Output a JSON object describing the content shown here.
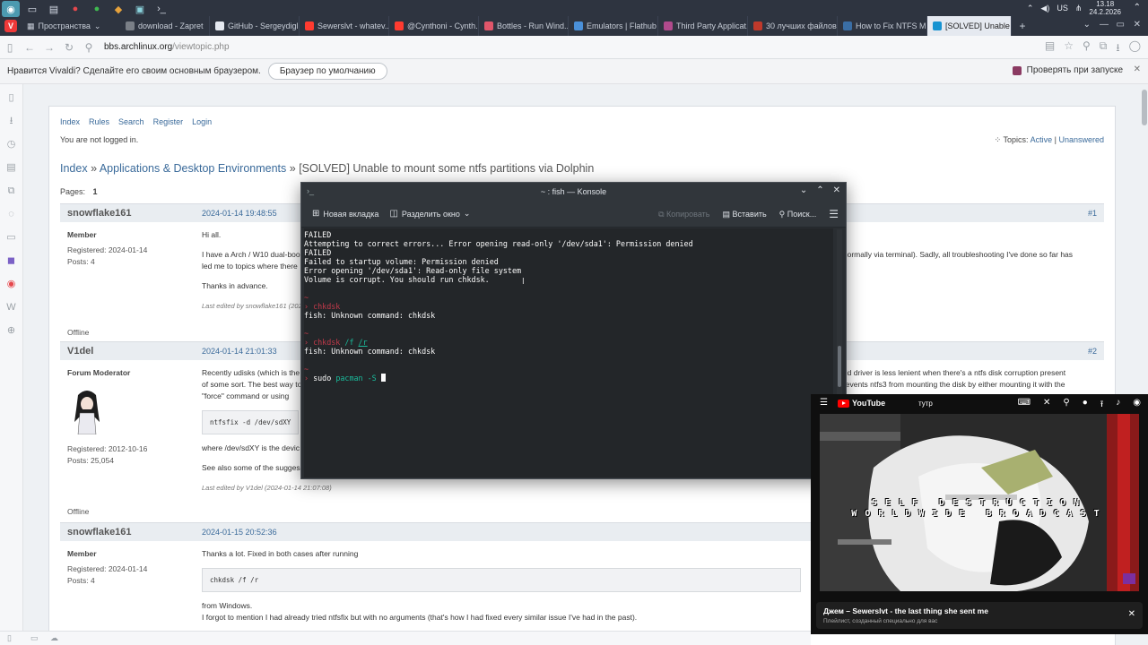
{
  "system": {
    "workspace_label": "Пространства",
    "keyboard_layout": "US",
    "time": "13.18",
    "date": "24.2.2026"
  },
  "tabs": [
    {
      "label": "download - Zapret",
      "color": "#7a7f87"
    },
    {
      "label": "GitHub - Sergeydigl...",
      "color": "#e5e9f0"
    },
    {
      "label": "Sewerslvt - whatev...",
      "color": "#ff3b30"
    },
    {
      "label": "@Cynthoni - Cynth...",
      "color": "#ff3b30"
    },
    {
      "label": "Bottles - Run Wind...",
      "color": "#e0566a"
    },
    {
      "label": "Emulators | Flathub",
      "color": "#4a90d9"
    },
    {
      "label": "Third Party Applicat...",
      "color": "#b04a8c"
    },
    {
      "label": "30 лучших файлов...",
      "color": "#c0392b"
    },
    {
      "label": "How to Fix NTFS M...",
      "color": "#3a6ea5"
    },
    {
      "label": "[SOLVED] Unable to m...",
      "color": "#1793d1"
    }
  ],
  "address": {
    "host": "bbs.archlinux.org",
    "path": "/viewtopic.php"
  },
  "notification": {
    "message": "Нравится Vivaldi? Сделайте его своим основным браузером.",
    "button": "Браузер по умолчанию",
    "checkbox_label": "Проверять при запуске"
  },
  "forum": {
    "nav": [
      "Index",
      "Rules",
      "Search",
      "Register",
      "Login"
    ],
    "not_logged": "You are not logged in.",
    "topics_label": "Topics:",
    "topics_active": "Active",
    "topics_sep": "|",
    "topics_unanswered": "Unanswered",
    "breadcrumb": {
      "index": "Index",
      "sep": "»",
      "category": "Applications & Desktop Environments",
      "current": "[SOLVED] Unable to mount some ntfs partitions via Dolphin"
    },
    "pages_label": "Pages:",
    "pages_current": "1",
    "posts": [
      {
        "author": "snowflake161",
        "date": "2024-01-14 19:48:55",
        "num": "#1",
        "role": "Member",
        "registered": "Registered: 2024-01-14",
        "postcount": "Posts: 4",
        "body": [
          "Hi all.",
          "I have a Arch / W10 dual-boo",
          "led me to topics where there",
          "Thanks in advance."
        ],
        "body_right": "hem normally via terminal). Sadly, all troubleshooting I've done so far has",
        "edited": "Last edited by snowflake161 (202",
        "status": "Offline"
      },
      {
        "author": "V1del",
        "date": "2024-01-14 21:01:33",
        "num": "#2",
        "role": "Forum Moderator",
        "registered": "Registered: 2012-10-16",
        "postcount": "Posts: 25,054",
        "body": [
          "Recently udisks (which is the",
          "of some sort. The best way to",
          "\"force\" command or using"
        ],
        "body_right_1": "el. Said driver is less lenient when there's a ntfs disk corruption present",
        "body_right_2": "hat prevents ntfs3 from mounting the disk by either mounting it with the",
        "code": "ntfsfix -d /dev/sdXY",
        "after_code": "where /dev/sdXY is the devic",
        "see_also": "See also some of the sugges",
        "edited": "Last edited by V1del (2024-01-14 21:07:08)",
        "status": "Offline"
      },
      {
        "author": "snowflake161",
        "date": "2024-01-15 20:52:36",
        "num": "#3",
        "role": "Member",
        "registered": "Registered: 2024-01-14",
        "postcount": "Posts: 4",
        "body_first": "Thanks a lot. Fixed in both cases after running",
        "code": "chkdsk /f /r",
        "after_code_1": "from Windows.",
        "after_code_2": "I forgot to mention I had already tried ntfsfix but with no arguments (that's how I had fixed every similar issue I've had in the past)."
      }
    ]
  },
  "konsole": {
    "title": "~ : fish — Konsole",
    "new_tab": "Новая вкладка",
    "split": "Разделить окно",
    "copy": "Копировать",
    "paste": "Вставить",
    "search": "Поиск...",
    "lines": {
      "l1": "FAILED",
      "l2": "Attempting to correct errors... Error opening read-only '/dev/sda1': Permission denied",
      "l3": "FAILED",
      "l4": "Failed to startup volume: Permission denied",
      "l5": "Error opening '/dev/sda1': Read-only file system",
      "l6": "Volume is corrupt. You should run chkdsk.",
      "tilde": "~",
      "cmd1": "chkdsk",
      "err1": "fish: Unknown command: chkdsk",
      "cmd2": "chkdsk",
      "cmd2_args1": "/f",
      "cmd2_args2": "/r",
      "err2": "fish: Unknown command: chkdsk",
      "prompt_cmd": "sudo",
      "prompt_arg": "pacman -S"
    }
  },
  "youtube": {
    "brand": "YouTube",
    "search": "тутр",
    "overlay_line1": "SELF DESTRUCTION",
    "overlay_line2": "WORLDWIDE BROADCAST",
    "now_playing": "Джем – Sewerslvt - the last thing she sent me",
    "subtitle": "Плейлист, созданный специально для вас"
  }
}
